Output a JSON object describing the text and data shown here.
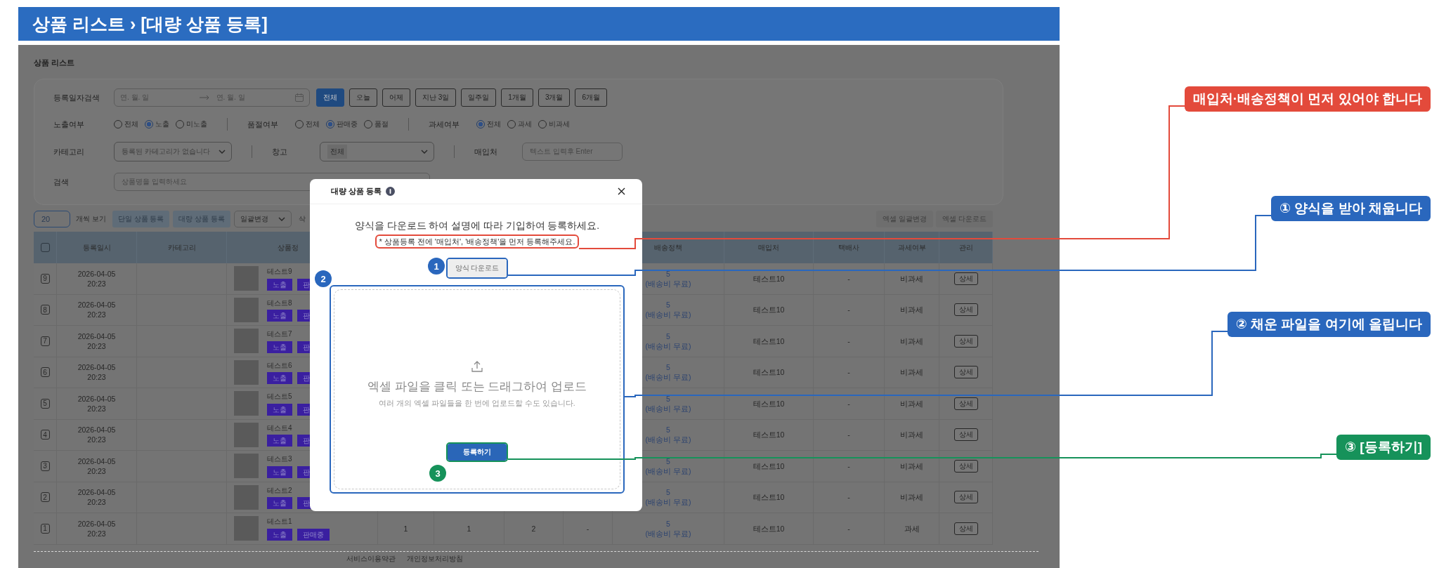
{
  "banner": {
    "title": "상품 리스트 › [대량 상품 등록]"
  },
  "page": {
    "title": "상품 리스트"
  },
  "filters": {
    "date": {
      "label": "등록일자검색",
      "start_placeholder": "연. 월. 일",
      "end_placeholder": "연. 월. 일",
      "presets": [
        {
          "label": "전체",
          "selected": true
        },
        {
          "label": "오늘",
          "selected": false
        },
        {
          "label": "어제",
          "selected": false
        },
        {
          "label": "지난 3일",
          "selected": false
        },
        {
          "label": "일주일",
          "selected": false
        },
        {
          "label": "1개월",
          "selected": false
        },
        {
          "label": "3개월",
          "selected": false
        },
        {
          "label": "6개월",
          "selected": false
        }
      ]
    },
    "radio_groups": [
      {
        "label": "노출여부",
        "options": [
          {
            "label": "전체",
            "selected": false
          },
          {
            "label": "노출",
            "selected": true
          },
          {
            "label": "미노출",
            "selected": false
          }
        ]
      },
      {
        "label": "품절여부",
        "options": [
          {
            "label": "전체",
            "selected": false
          },
          {
            "label": "판매중",
            "selected": true
          },
          {
            "label": "품절",
            "selected": false
          }
        ]
      },
      {
        "label": "과세여부",
        "options": [
          {
            "label": "전체",
            "selected": true
          },
          {
            "label": "과세",
            "selected": false
          },
          {
            "label": "비과세",
            "selected": false
          }
        ]
      }
    ],
    "category": {
      "label": "카테고리",
      "value": "등록된 카테고리가 없습니다"
    },
    "warehouse": {
      "label": "창고",
      "value": "전체"
    },
    "supplier": {
      "label": "매입처",
      "placeholder": "텍스트 입력후 Enter"
    },
    "search": {
      "label": "검색",
      "placeholder": "상품명을 입력하세요"
    }
  },
  "toolbar": {
    "page_size": "20",
    "page_size_label": "개씩 보기",
    "buttons": [
      "단일 상품 등록",
      "대량 상품 등록"
    ],
    "bulk_select": "일괄변경",
    "delete": "삭",
    "right_buttons": [
      "엑셀 일괄변경",
      "엑셀 다운로드"
    ]
  },
  "table": {
    "select_all_checked": false,
    "columns": [
      "등록일시",
      "카테고리",
      "상품정",
      "배송정책",
      "매입처",
      "택배사",
      "과세여부",
      "관리"
    ],
    "rows": [
      {
        "number": "9",
        "date": "2026-04-05",
        "time": "20:23",
        "name": "테스트9",
        "badges": [
          "노출",
          "판"
        ],
        "shipping": "5",
        "shipping_note": "(배송비 무료)",
        "supplier": "테스트10",
        "courier": "-",
        "tax": "비과세",
        "action": "상세"
      },
      {
        "number": "8",
        "date": "2026-04-05",
        "time": "20:23",
        "name": "테스트8",
        "badges": [
          "노출",
          "판"
        ],
        "shipping": "5",
        "shipping_note": "(배송비 무료)",
        "supplier": "테스트10",
        "courier": "-",
        "tax": "비과세",
        "action": "상세"
      },
      {
        "number": "7",
        "date": "2026-04-05",
        "time": "20:23",
        "name": "테스트7",
        "badges": [
          "노출",
          "판"
        ],
        "shipping": "5",
        "shipping_note": "(배송비 무료)",
        "supplier": "테스트10",
        "courier": "-",
        "tax": "비과세",
        "action": "상세"
      },
      {
        "number": "6",
        "date": "2026-04-05",
        "time": "20:23",
        "name": "테스트6",
        "badges": [
          "노출",
          "판"
        ],
        "shipping": "5",
        "shipping_note": "(배송비 무료)",
        "supplier": "테스트10",
        "courier": "-",
        "tax": "비과세",
        "action": "상세"
      },
      {
        "number": "5",
        "date": "2026-04-05",
        "time": "20:23",
        "name": "테스트5",
        "badges": [
          "노출",
          "판"
        ],
        "shipping": "5",
        "shipping_note": "(배송비 무료)",
        "supplier": "테스트10",
        "courier": "-",
        "tax": "비과세",
        "action": "상세"
      },
      {
        "number": "4",
        "date": "2026-04-05",
        "time": "20:23",
        "name": "테스트4",
        "badges": [
          "노출",
          "판"
        ],
        "shipping": "5",
        "shipping_note": "(배송비 무료)",
        "supplier": "테스트10",
        "courier": "-",
        "tax": "비과세",
        "action": "상세"
      },
      {
        "number": "3",
        "date": "2026-04-05",
        "time": "20:23",
        "name": "테스트3",
        "badges": [
          "노출",
          "판"
        ],
        "shipping": "5",
        "shipping_note": "(배송비 무료)",
        "supplier": "테스트10",
        "courier": "-",
        "tax": "비과세",
        "action": "상세"
      },
      {
        "number": "2",
        "date": "2026-04-05",
        "time": "20:23",
        "name": "테스트2",
        "badges": [
          "노출",
          "판"
        ],
        "shipping": "5",
        "shipping_note": "(배송비 무료)",
        "supplier": "테스트10",
        "courier": "-",
        "tax": "비과세",
        "action": "상세"
      },
      {
        "number": "1",
        "date": "2026-04-05",
        "time": "20:23",
        "name": "테스트1",
        "badges": [
          "노출",
          "판매중"
        ],
        "extra": [
          "1",
          "1",
          "2",
          "-"
        ],
        "shipping": "5",
        "shipping_note": "(배송비 무료)",
        "supplier": "테스트10",
        "courier": "-",
        "tax": "과세",
        "action": "상세"
      }
    ]
  },
  "footer": {
    "links": [
      "서비스이용약관",
      "개인정보처리방침"
    ]
  },
  "modal": {
    "title": "대량 상품 등록",
    "instruction": "양식을 다운로드 하여 설명에 따라 기입하여 등록하세요.",
    "note": "* 상품등록 전에 '매입처', '배송정책'을 먼저 등록해주세요.",
    "download_button": "양식 다운로드",
    "dropzone_title": "엑셀 파일을 클릭 또는 드래그하여 업로드",
    "dropzone_hint": "여러 개의 엑셀 파일들을 한 번에 업로드할 수도 있습니다.",
    "submit_button": "등록하기"
  },
  "annotations": [
    {
      "kind": "warning",
      "text": "매입처·배송정책이 먼저 있어야 합니다",
      "color": "#e34a3b"
    },
    {
      "kind": "step",
      "marker": "1",
      "text": "① 양식을 받아 채웁니다",
      "color": "#2a67bd"
    },
    {
      "kind": "step",
      "marker": "2",
      "text": "② 채운 파일을 여기에 올립니다",
      "color": "#2a67bd"
    },
    {
      "kind": "step",
      "marker": "3",
      "text": "③ [등록하기]",
      "color": "#16925a"
    }
  ]
}
